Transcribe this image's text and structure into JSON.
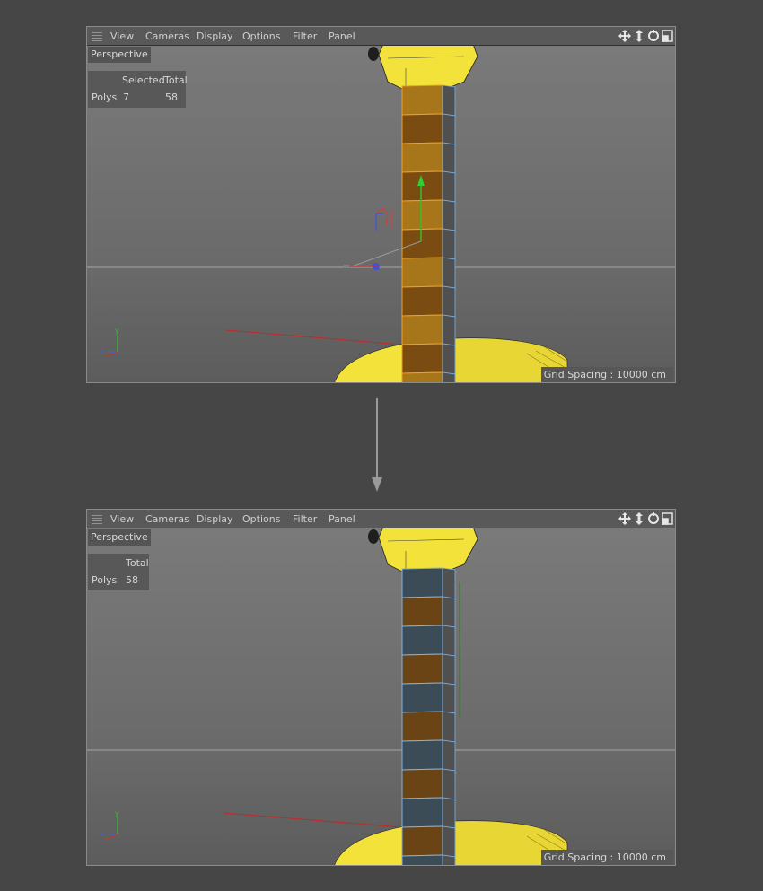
{
  "menu": {
    "items": [
      "View",
      "Cameras",
      "Display",
      "Options",
      "Filter",
      "Panel"
    ],
    "tool_icons": [
      "move-view-icon",
      "dolly-view-icon",
      "rotate-view-icon",
      "maximize-view-icon"
    ]
  },
  "viewport_top": {
    "camera_label": "Perspective",
    "stats": {
      "header_selected": "Selected",
      "header_total": "Total",
      "row_label": "Polys",
      "selected": "7",
      "total": "58"
    },
    "grid_spacing": "Grid Spacing : 10000 cm"
  },
  "viewport_bottom": {
    "camera_label": "Perspective",
    "stats": {
      "header_total": "Total",
      "row_label": "Polys",
      "total": "58"
    },
    "grid_spacing": "Grid Spacing : 10000 cm"
  },
  "colors": {
    "selection_orange": "#f0a020",
    "object_yellow": "#f2e23a",
    "face_brown": "#6b4416",
    "face_blue_grey": "#3c4c56",
    "edge_blue": "#7eb2e0",
    "axis_red": "#d43030",
    "axis_green": "#30c030",
    "axis_blue": "#4050e0"
  }
}
